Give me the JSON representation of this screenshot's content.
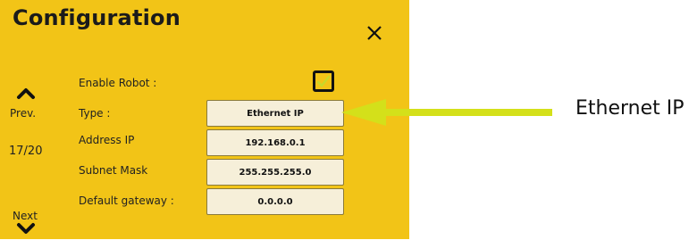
{
  "dialog": {
    "title": "Configuration",
    "close_glyph": "✕",
    "prev_label": "Prev.",
    "next_label": "Next",
    "counter": "17/20",
    "bg_color": "#f2c417"
  },
  "fields": {
    "enable_robot": {
      "label": "Enable Robot :",
      "checked": true
    },
    "type": {
      "label": "Type :",
      "value": "Ethernet IP"
    },
    "address_ip": {
      "label": "Address IP",
      "value": "192.168.0.1"
    },
    "subnet_mask": {
      "label": "Subnet Mask",
      "value": "255.255.255.0"
    },
    "default_gateway": {
      "label": "Default gateway :",
      "value": "0.0.0.0"
    }
  },
  "callout": {
    "text": "Ethernet IP",
    "arrow_color": "#d4e01a"
  }
}
